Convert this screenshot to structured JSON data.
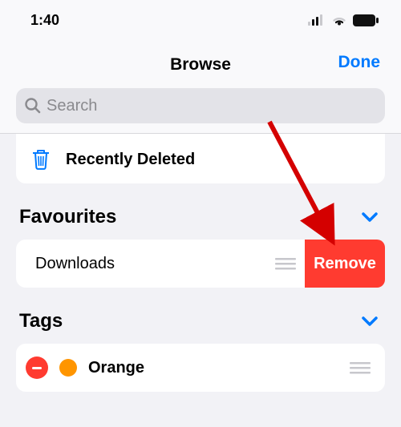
{
  "status": {
    "time": "1:40"
  },
  "header": {
    "title": "Browse",
    "done": "Done"
  },
  "search": {
    "placeholder": "Search"
  },
  "recent": {
    "label": "Recently Deleted"
  },
  "favourites": {
    "title": "Favourites",
    "item": {
      "label": "Downloads",
      "remove": "Remove"
    }
  },
  "tags": {
    "title": "Tags",
    "item": {
      "label": "Orange",
      "color": "#ff9500"
    }
  }
}
